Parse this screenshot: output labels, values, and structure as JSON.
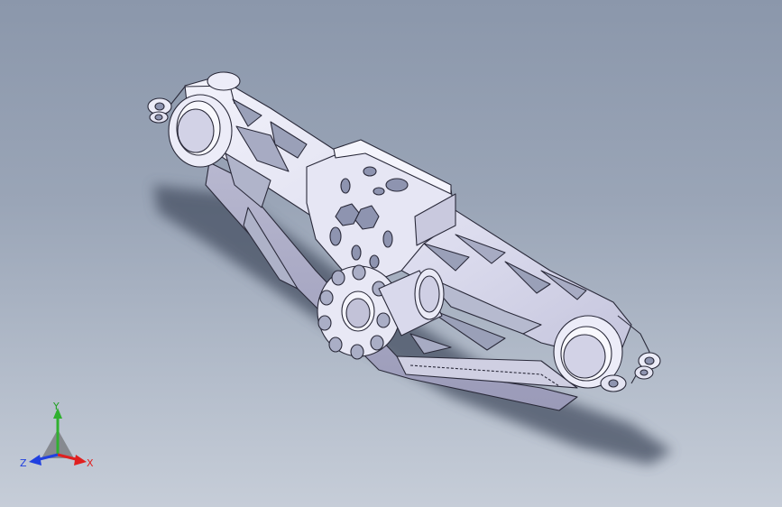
{
  "viewport": {
    "background_top": "#8b97ab",
    "background_bottom": "#c6cdd8"
  },
  "model": {
    "type": "3d-cad-part",
    "description_icon": "motorcycle-triple-clamp-frame-part",
    "part_color": "#e4e4f2",
    "edge_color": "#2a2a3a",
    "shadow_color": "#4a5264"
  },
  "triad": {
    "x_label": "X",
    "y_label": "Y",
    "z_label": "Z",
    "x_color": "#e02020",
    "y_color": "#30b030",
    "z_color": "#2040e0"
  }
}
